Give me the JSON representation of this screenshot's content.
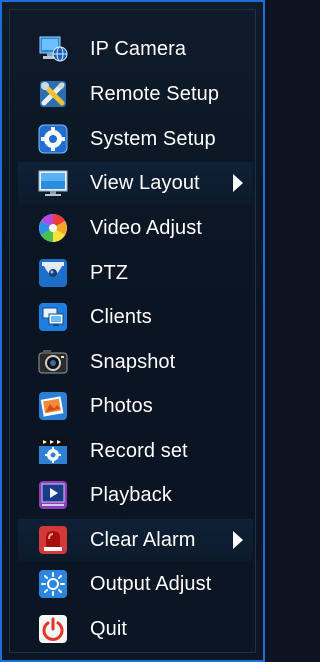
{
  "menu": {
    "items": [
      {
        "label": "IP Camera"
      },
      {
        "label": "Remote Setup"
      },
      {
        "label": "System Setup"
      },
      {
        "label": "View Layout"
      },
      {
        "label": "Video Adjust"
      },
      {
        "label": "PTZ"
      },
      {
        "label": "Clients"
      },
      {
        "label": "Snapshot"
      },
      {
        "label": "Photos"
      },
      {
        "label": "Record set"
      },
      {
        "label": "Playback"
      },
      {
        "label": "Clear Alarm"
      },
      {
        "label": "Output Adjust"
      },
      {
        "label": "Quit"
      }
    ]
  },
  "icons": [
    "ip-camera-icon",
    "remote-setup-icon",
    "system-setup-icon",
    "view-layout-icon",
    "video-adjust-icon",
    "ptz-icon",
    "clients-icon",
    "snapshot-icon",
    "photos-icon",
    "record-set-icon",
    "playback-icon",
    "clear-alarm-icon",
    "output-adjust-icon",
    "quit-icon"
  ],
  "colors": {
    "accent_border": "#1b6fd6",
    "background": "#0b1420",
    "highlight": "#0f2136",
    "text": "#ffffff"
  }
}
